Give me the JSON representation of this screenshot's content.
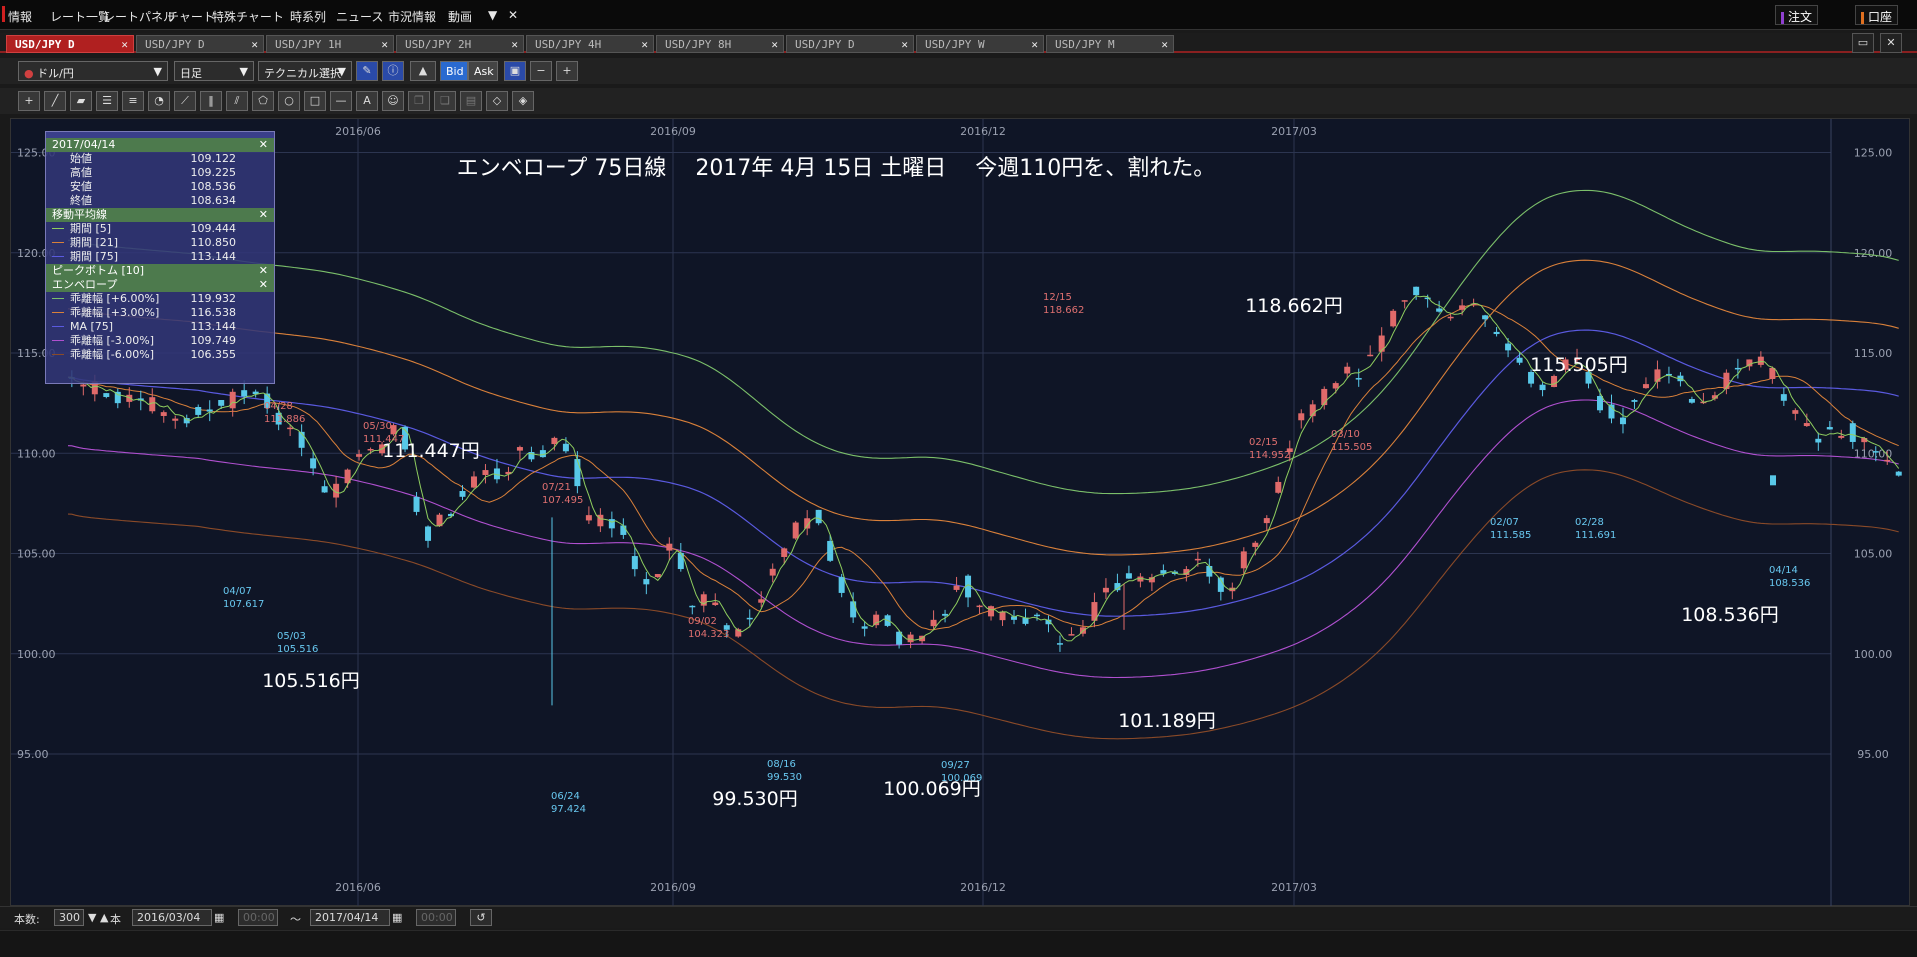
{
  "menubar": {
    "items": [
      "情報",
      "レート一覧",
      "レートパネル",
      "チャート",
      "特殊チャート",
      "時系列",
      "ニュース",
      "市況情報",
      "動画"
    ],
    "order_label": "注文",
    "account_label": "口座"
  },
  "tabs": [
    {
      "label": "USD/JPY D",
      "active": true
    },
    {
      "label": "USD/JPY D"
    },
    {
      "label": "USD/JPY 1H"
    },
    {
      "label": "USD/JPY 2H"
    },
    {
      "label": "USD/JPY 4H"
    },
    {
      "label": "USD/JPY 8H"
    },
    {
      "label": "USD/JPY D"
    },
    {
      "label": "USD/JPY W"
    },
    {
      "label": "USD/JPY M"
    }
  ],
  "toolbar": {
    "symbol": "ドル/円",
    "timeframe": "日足",
    "technical": "テクニカル選択",
    "bid": "Bid",
    "ask": "Ask"
  },
  "info_panel": {
    "date": "2017/04/14",
    "ohlc": [
      {
        "label": "始値",
        "value": "109.122"
      },
      {
        "label": "高値",
        "value": "109.225"
      },
      {
        "label": "安値",
        "value": "108.536"
      },
      {
        "label": "終値",
        "value": "108.634"
      }
    ],
    "ma_title": "移動平均線",
    "ma": [
      {
        "label": "期間 [5]",
        "value": "109.444",
        "color": "#8fce5f"
      },
      {
        "label": "期間 [21]",
        "value": "110.850",
        "color": "#d9803a"
      },
      {
        "label": "期間 [75]",
        "value": "113.144",
        "color": "#5a5ae0"
      }
    ],
    "peak_title": "ピークボトム [10]",
    "env_title": "エンベロープ",
    "env": [
      {
        "label": "乖離幅 [+6.00%]",
        "value": "119.932",
        "color": "#7bbf6a"
      },
      {
        "label": "乖離幅 [+3.00%]",
        "value": "116.538",
        "color": "#d9803a"
      },
      {
        "label": "MA [75]",
        "value": "113.144",
        "color": "#5a5ae0"
      },
      {
        "label": "乖離幅 [-3.00%]",
        "value": "109.749",
        "color": "#b050d0"
      },
      {
        "label": "乖離幅 [-6.00%]",
        "value": "106.355",
        "color": "#8a4a28"
      }
    ]
  },
  "chart_data": {
    "type": "candlestick",
    "title": "エンベロープ 75日線　 2017年 4月 15日 土曜日　 今週110円を、割れた。",
    "ylim": [
      92.5,
      127.5
    ],
    "y_ticks": [
      "95.00",
      "100.00",
      "105.00",
      "110.00",
      "115.00",
      "120.00",
      "125.00"
    ],
    "x_ticks": [
      "2016/06",
      "2016/09",
      "2016/12",
      "2017/03"
    ],
    "colors": {
      "up": "#e06a6a",
      "down": "#58c8e8",
      "ma5": "#8fce5f",
      "ma21": "#d9803a",
      "ma75": "#5a5ae0",
      "env_p6": "#7bbf6a",
      "env_p3": "#d9803a",
      "env_m3": "#b050d0",
      "env_m6": "#8a4a28"
    },
    "peaks": [
      {
        "date": "04/28",
        "value": "111.886",
        "type": "high"
      },
      {
        "date": "05/30",
        "value": "111.447",
        "type": "high"
      },
      {
        "date": "07/21",
        "value": "107.495",
        "type": "high"
      },
      {
        "date": "09/02",
        "value": "104.323",
        "type": "high"
      },
      {
        "date": "12/15",
        "value": "118.662",
        "type": "high"
      },
      {
        "date": "02/15",
        "value": "114.952",
        "type": "high"
      },
      {
        "date": "03/10",
        "value": "115.505",
        "type": "high"
      }
    ],
    "bottoms": [
      {
        "date": "04/07",
        "value": "107.617",
        "type": "low"
      },
      {
        "date": "05/03",
        "value": "105.516",
        "type": "low"
      },
      {
        "date": "06/24",
        "value": "97.424",
        "type": "low"
      },
      {
        "date": "08/16",
        "value": "99.530",
        "type": "low"
      },
      {
        "date": "09/27",
        "value": "100.069",
        "type": "low"
      },
      {
        "date": "02/07",
        "value": "111.585",
        "type": "low"
      },
      {
        "date": "02/28",
        "value": "111.691",
        "type": "low"
      },
      {
        "date": "04/14",
        "value": "108.536",
        "type": "low"
      }
    ],
    "annotations": [
      "111.447円",
      "105.516円",
      "99.530円",
      "100.069円",
      "101.189円",
      "118.662円",
      "115.505円",
      "108.536円"
    ],
    "close_path": [
      [
        0,
        113.8
      ],
      [
        10,
        113.0
      ],
      [
        20,
        112.6
      ],
      [
        30,
        111.6
      ],
      [
        40,
        112.5
      ],
      [
        50,
        113.1
      ],
      [
        55,
        111.8
      ],
      [
        62,
        110.2
      ],
      [
        66,
        108.4
      ],
      [
        68,
        107.8
      ],
      [
        75,
        109.4
      ],
      [
        82,
        110.6
      ],
      [
        86,
        111.8
      ],
      [
        88,
        110.4
      ],
      [
        91,
        107.2
      ],
      [
        94,
        106.0
      ],
      [
        100,
        107.2
      ],
      [
        105,
        108.6
      ],
      [
        112,
        109.0
      ],
      [
        118,
        110.0
      ],
      [
        124,
        110.2
      ],
      [
        128,
        111.2
      ],
      [
        132,
        109.6
      ],
      [
        135,
        107.0
      ],
      [
        138,
        106.8
      ],
      [
        144,
        106.2
      ],
      [
        148,
        104.6
      ],
      [
        152,
        103.6
      ],
      [
        157,
        105.6
      ],
      [
        160,
        104.2
      ],
      [
        163,
        102.0
      ],
      [
        167,
        102.8
      ],
      [
        170,
        101.8
      ],
      [
        174,
        100.6
      ],
      [
        178,
        101.6
      ],
      [
        182,
        103.6
      ],
      [
        186,
        104.6
      ],
      [
        190,
        106.2
      ],
      [
        194,
        107.1
      ],
      [
        197,
        106.0
      ],
      [
        200,
        104.4
      ],
      [
        203,
        102.6
      ],
      [
        206,
        101.4
      ],
      [
        212,
        101.8
      ],
      [
        216,
        100.8
      ],
      [
        220,
        100.6
      ],
      [
        225,
        101.6
      ],
      [
        230,
        102.5
      ],
      [
        233,
        103.9
      ],
      [
        236,
        102.8
      ],
      [
        240,
        102.2
      ],
      [
        246,
        102.0
      ],
      [
        252,
        101.6
      ],
      [
        256,
        101.2
      ],
      [
        260,
        100.6
      ],
      [
        264,
        101.2
      ],
      [
        268,
        102.2
      ],
      [
        272,
        103.4
      ],
      [
        276,
        103.6
      ],
      [
        282,
        103.9
      ],
      [
        288,
        104.0
      ],
      [
        294,
        104.5
      ],
      [
        298,
        103.9
      ],
      [
        302,
        103.0
      ],
      [
        306,
        104.4
      ],
      [
        310,
        105.5
      ],
      [
        314,
        107.6
      ],
      [
        318,
        110.0
      ],
      [
        322,
        112.0
      ],
      [
        326,
        112.6
      ],
      [
        330,
        113.6
      ],
      [
        334,
        113.9
      ],
      [
        338,
        114.2
      ],
      [
        342,
        115.0
      ],
      [
        346,
        117.0
      ],
      [
        350,
        118.0
      ],
      [
        354,
        117.6
      ],
      [
        358,
        117.4
      ],
      [
        362,
        116.9
      ],
      [
        366,
        117.8
      ],
      [
        370,
        117.0
      ],
      [
        374,
        115.8
      ],
      [
        378,
        114.8
      ],
      [
        382,
        113.6
      ],
      [
        386,
        113.3
      ],
      [
        390,
        114.2
      ],
      [
        394,
        114.8
      ],
      [
        398,
        112.8
      ],
      [
        402,
        112.2
      ],
      [
        406,
        111.9
      ],
      [
        410,
        113.0
      ],
      [
        414,
        114.0
      ],
      [
        418,
        113.7
      ],
      [
        422,
        113.2
      ],
      [
        426,
        112.2
      ],
      [
        430,
        113.0
      ],
      [
        434,
        114.0
      ],
      [
        438,
        114.7
      ],
      [
        442,
        114.8
      ],
      [
        446,
        113.5
      ],
      [
        450,
        112.2
      ],
      [
        454,
        111.2
      ],
      [
        458,
        110.9
      ],
      [
        462,
        111.2
      ],
      [
        466,
        111.0
      ],
      [
        470,
        110.6
      ],
      [
        474,
        110.0
      ],
      [
        478,
        108.7
      ]
    ]
  },
  "status": {
    "count_label": "本数:",
    "count_value": "300",
    "unit": "本",
    "from_date": "2016/03/04",
    "from_time": "00:00",
    "tilde": "～",
    "to_date": "2017/04/14",
    "to_time": "00:00"
  }
}
